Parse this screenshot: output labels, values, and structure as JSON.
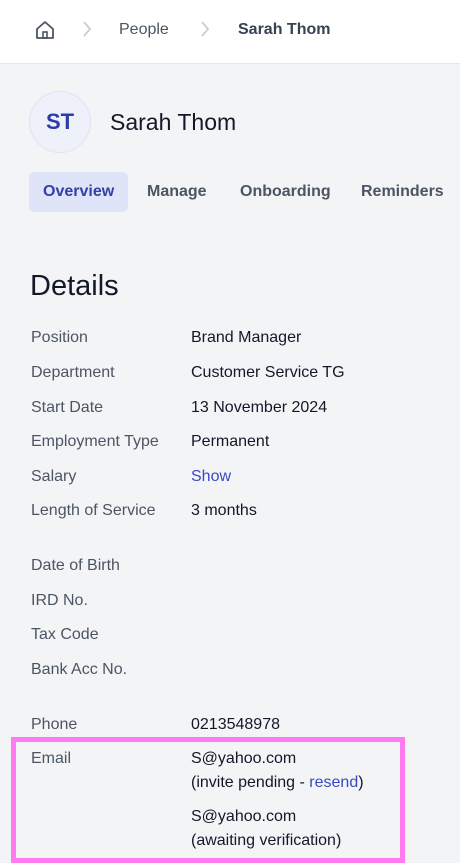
{
  "breadcrumb": {
    "home_icon": "home-icon",
    "items": [
      "People",
      "Sarah Thom"
    ]
  },
  "profile": {
    "initials": "ST",
    "name": "Sarah Thom"
  },
  "tabs": [
    {
      "label": "Overview",
      "active": true
    },
    {
      "label": "Manage",
      "active": false
    },
    {
      "label": "Onboarding",
      "active": false
    },
    {
      "label": "Reminders",
      "active": false
    }
  ],
  "details": {
    "title": "Details",
    "position": {
      "label": "Position",
      "value": "Brand Manager"
    },
    "department": {
      "label": "Department",
      "value": "Customer Service TG"
    },
    "start_date": {
      "label": "Start Date",
      "value": "13 November 2024"
    },
    "employment_type": {
      "label": "Employment Type",
      "value": "Permanent"
    },
    "salary": {
      "label": "Salary",
      "value": "Show"
    },
    "length_of_service": {
      "label": "Length of Service",
      "value": "3 months"
    },
    "date_of_birth": {
      "label": "Date of Birth",
      "value": ""
    },
    "ird_no": {
      "label": "IRD No.",
      "value": ""
    },
    "tax_code": {
      "label": "Tax Code",
      "value": ""
    },
    "bank_acc_no": {
      "label": "Bank Acc No.",
      "value": ""
    },
    "phone": {
      "label": "Phone",
      "value": "0213548978"
    },
    "email": {
      "label": "Email",
      "primary": "S@yahoo.com",
      "status_prefix": "(invite pending - ",
      "resend_label": "resend",
      "status_suffix": ")",
      "secondary": "S@yahoo.com",
      "secondary_status": "(awaiting verification)"
    }
  },
  "colors": {
    "accent": "#3b48c4",
    "active_tab_bg": "#dfe4f8",
    "highlight_border": "#ff7cf0",
    "page_bg": "#f3f4f6"
  }
}
